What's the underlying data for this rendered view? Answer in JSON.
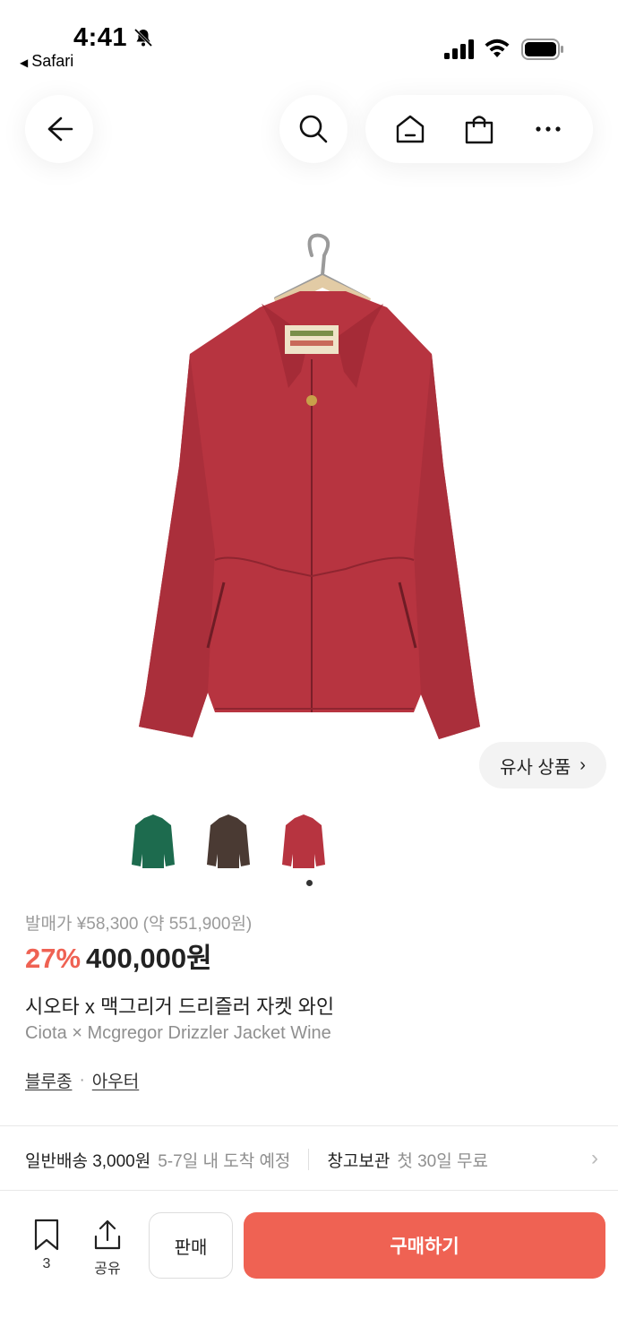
{
  "status_bar": {
    "time": "4:41",
    "back_app": "Safari"
  },
  "header": {
    "icons": [
      "back-arrow-icon",
      "search-icon",
      "home-icon",
      "shopping-bag-icon",
      "more-icon"
    ]
  },
  "product": {
    "image_alt": "red-wine zip jacket on hanger",
    "main_color": "#b73440",
    "similar_label": "유사 상품",
    "thumbnails": [
      {
        "color": "#1d6b4e"
      },
      {
        "color": "#4a3a33"
      },
      {
        "color": "#b73440"
      }
    ],
    "original_price": "발매가 ¥58,300 (약 551,900원)",
    "discount": "27%",
    "price": "400,000원",
    "title_ko": "시오타 x 맥그리거 드리즐러 자켓 와인",
    "title_en": "Ciota × Mcgregor Drizzler Jacket Wine",
    "categories": [
      "블루종",
      "아우터"
    ],
    "category_sep": "·"
  },
  "shipping": {
    "method": "일반배송 3,000원",
    "method_eta": "5-7일 내 도착 예정",
    "storage": "창고보관",
    "storage_note": "첫 30일 무료"
  },
  "bottom_bar": {
    "bookmark_count": "3",
    "share_label": "공유",
    "sell_label": "판매",
    "buy_label": "구매하기"
  },
  "colors": {
    "accent": "#ef6253",
    "muted_text": "#8f8f8f"
  }
}
